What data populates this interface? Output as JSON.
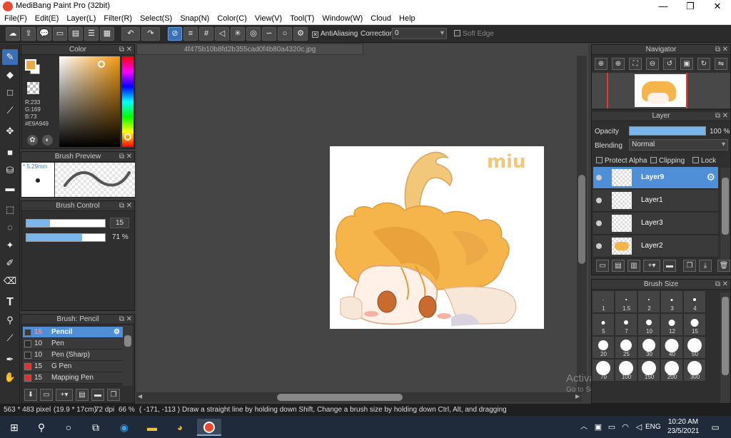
{
  "window": {
    "title": "MediBang Paint Pro (32bit)",
    "minimize": "—",
    "maximize": "❐",
    "close": "✕"
  },
  "menu": [
    "File(F)",
    "Edit(E)",
    "Layer(L)",
    "Filter(R)",
    "Select(S)",
    "Snap(N)",
    "Color(C)",
    "View(V)",
    "Tool(T)",
    "Window(W)",
    "Cloud",
    "Help"
  ],
  "toolbar": {
    "antialiasing": "AntiAliasing",
    "correction_label": "Correction",
    "correction_value": "0",
    "soft_edge": "Soft Edge"
  },
  "color_panel": {
    "title": "Color",
    "r": "R:233",
    "g": "G:169",
    "b": "B:73",
    "hex": "#E9A949",
    "primary": "#e9a949",
    "secondary": "#ffffff"
  },
  "brush_preview": {
    "title": "Brush Preview",
    "size": "5.29mm"
  },
  "brush_control": {
    "title": "Brush Control",
    "size_value": "15",
    "opacity_value": "71 %",
    "size_fill": 0.3,
    "opacity_fill": 0.71
  },
  "brush_list": {
    "title": "Brush: Pencil",
    "items": [
      {
        "size": "15",
        "name": "Pencil",
        "color": "#3a3a3a",
        "selected": true
      },
      {
        "size": "10",
        "name": "Pen",
        "color": "#2a2a2a",
        "selected": false
      },
      {
        "size": "10",
        "name": "Pen (Sharp)",
        "color": "#2a2a2a",
        "selected": false
      },
      {
        "size": "15",
        "name": "G Pen",
        "color": "#e03030",
        "selected": false
      },
      {
        "size": "15",
        "name": "Mapping Pen",
        "color": "#e03030",
        "selected": false
      }
    ]
  },
  "document": {
    "tab": "4f475b10b8fd2b355cad0f4b80a4320c.jpg",
    "signature": "miu"
  },
  "navigator": {
    "title": "Navigator"
  },
  "layer_panel": {
    "title": "Layer",
    "opacity_label": "Opacity",
    "opacity_value": "100 %",
    "blending_label": "Blending",
    "blending_value": "Normal",
    "protect_alpha": "Protect Alpha",
    "clipping": "Clipping",
    "lock": "Lock",
    "layers": [
      {
        "name": "Layer9",
        "selected": true
      },
      {
        "name": "Layer1",
        "selected": false
      },
      {
        "name": "Layer3",
        "selected": false
      },
      {
        "name": "Layer2",
        "selected": false
      }
    ]
  },
  "brush_size": {
    "title": "Brush Size",
    "sizes": [
      "1",
      "1.5",
      "2",
      "3",
      "4",
      "5",
      "7",
      "10",
      "12",
      "15",
      "20",
      "25",
      "30",
      "40",
      "50",
      "70",
      "100",
      "150",
      "200",
      "300"
    ]
  },
  "status": {
    "dimensions": "563 * 483 pixel",
    "physical": "(19.9 * 17cm)",
    "dpi": "72 dpi",
    "zoom": "66 %",
    "coords": "( -171, -113 )",
    "hint": "Draw a straight line by holding down Shift, Change a brush size by holding down Ctrl, Alt, and dragging"
  },
  "watermark": {
    "line1": "Activate Windows",
    "line2": "Go to Settings to activate Windows."
  },
  "taskbar": {
    "time": "10:20 AM",
    "date": "23/5/2021",
    "lang": "ENG"
  }
}
